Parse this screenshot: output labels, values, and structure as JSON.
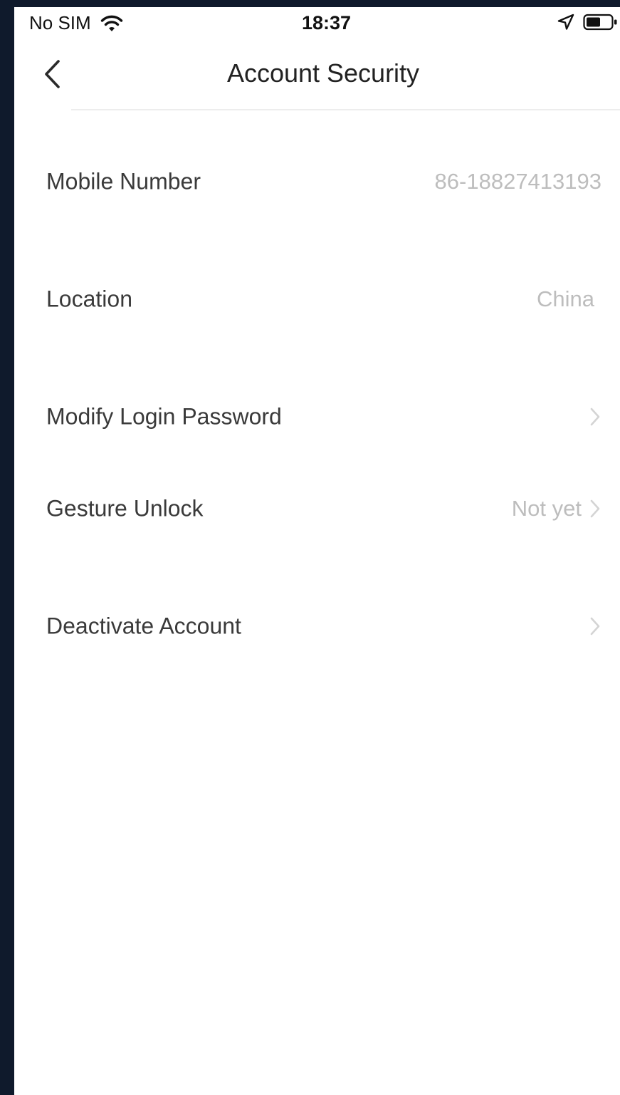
{
  "status_bar": {
    "carrier": "No SIM",
    "time": "18:37"
  },
  "nav": {
    "title": "Account Security",
    "back_icon": "chevron-left-icon"
  },
  "rows": [
    {
      "label": "Mobile Number",
      "value": "86-18827413193",
      "chevron": false
    },
    {
      "label": "Location",
      "value": "China",
      "chevron": false
    },
    {
      "label": "Modify Login Password",
      "value": "",
      "chevron": true
    },
    {
      "label": "Gesture Unlock",
      "value": "Not yet",
      "chevron": true
    },
    {
      "label": "Deactivate Account",
      "value": "",
      "chevron": true
    }
  ],
  "colors": {
    "background": "#ffffff",
    "frame": "#0f1a2c",
    "label_text": "#3a3a3a",
    "value_text": "#bdbdbd",
    "divider": "#ededed"
  }
}
